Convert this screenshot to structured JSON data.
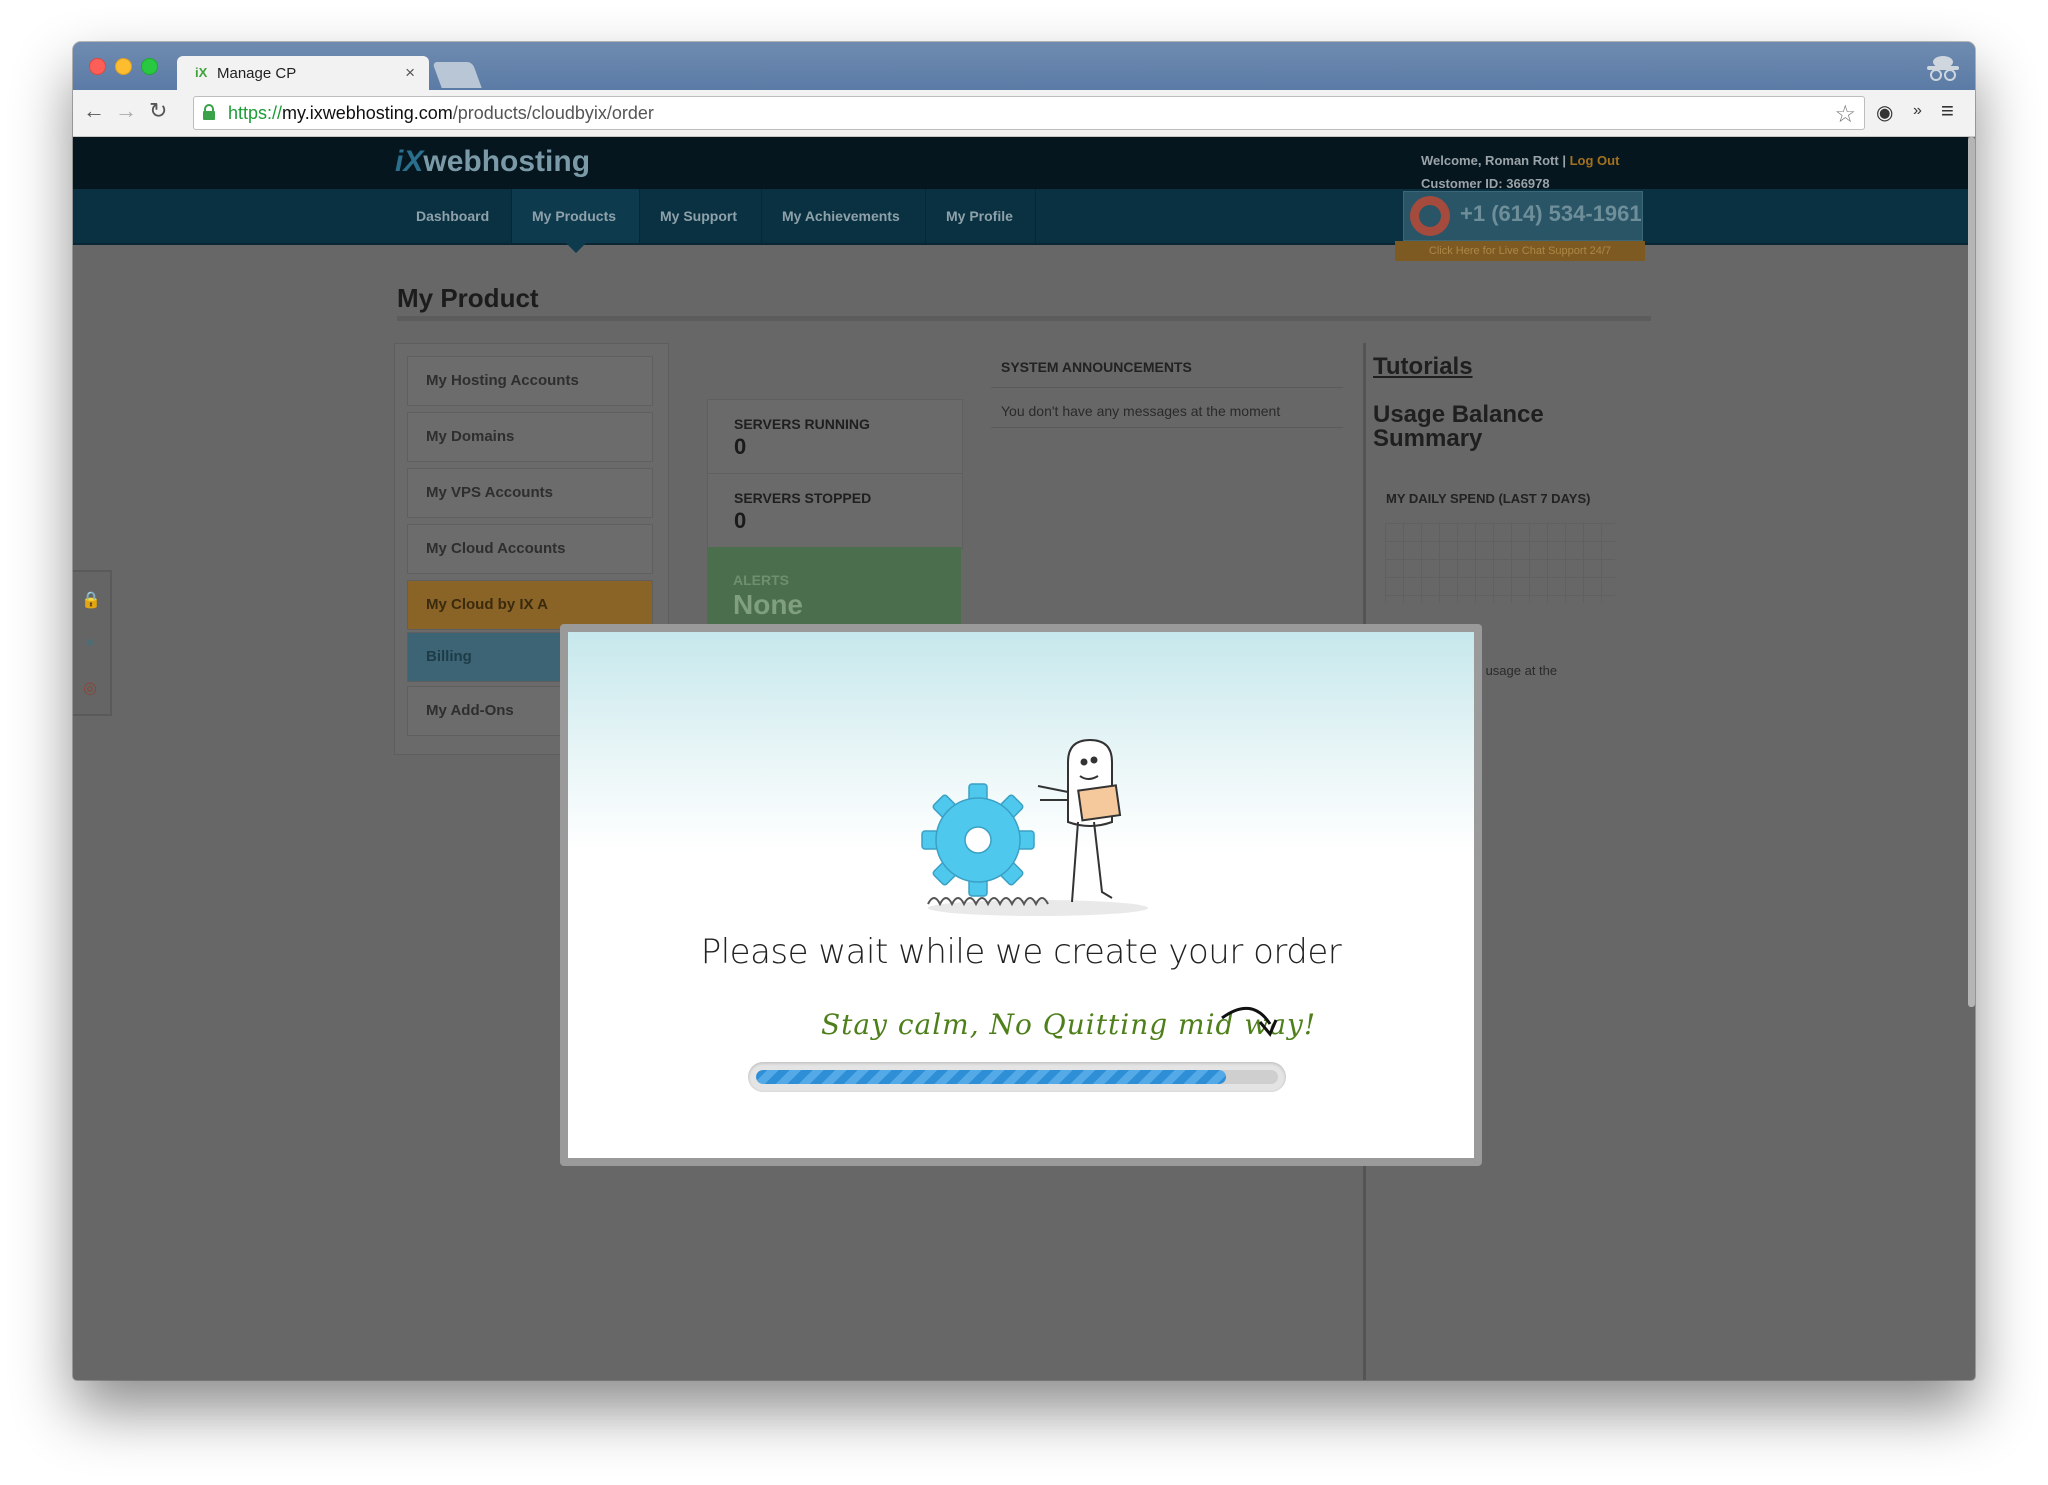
{
  "browser": {
    "tab_title": "Manage CP",
    "tab_close": "×",
    "url_scheme": "https://",
    "url_host": "my.ixwebhosting.com",
    "url_path": "/products/cloudbyix/order",
    "overflow": "»"
  },
  "site": {
    "logo_prefix": "iX",
    "logo_text": "webhosting",
    "welcome": "Welcome, Roman Rott |",
    "logout": "Log Out",
    "customer_id": "Customer ID: 366978",
    "phone": "+1 (614) 534-1961",
    "chat_text": "Click Here for Live Chat Support 24/7"
  },
  "nav": {
    "items": [
      {
        "label": "Dashboard"
      },
      {
        "label": "My Products",
        "active": true
      },
      {
        "label": "My Support"
      },
      {
        "label": "My Achievements"
      },
      {
        "label": "My Profile"
      }
    ]
  },
  "main": {
    "title": "My Product",
    "sidebar": [
      {
        "label": "My Hosting Accounts"
      },
      {
        "label": "My Domains"
      },
      {
        "label": "My VPS Accounts"
      },
      {
        "label": "My Cloud Accounts"
      },
      {
        "label": "My Cloud by IX A"
      },
      {
        "label": "Billing"
      },
      {
        "label": "My Add-Ons"
      }
    ],
    "stats": [
      {
        "label": "SERVERS RUNNING",
        "value": "0"
      },
      {
        "label": "SERVERS STOPPED",
        "value": "0"
      }
    ],
    "alerts_label": "ALERTS",
    "alerts_value": "None",
    "announcements_title": "SYSTEM ANNOUNCEMENTS",
    "announcements_msg": "You don't have any messages at the moment",
    "tutorials": "Tutorials",
    "usage_title": "Usage Balance Summary",
    "daily_spend": "MY DAILY SPEND (LAST 7 DAYS)",
    "usage_note": "any usage at the"
  },
  "modal": {
    "message": "Please wait while we create your order",
    "hint": "Stay calm, No Quitting mid way!",
    "progress": 0.9
  },
  "colors": {
    "gear": "#4fc8ee",
    "progress": "#2e8fd6",
    "hint": "#4e7f1b"
  }
}
